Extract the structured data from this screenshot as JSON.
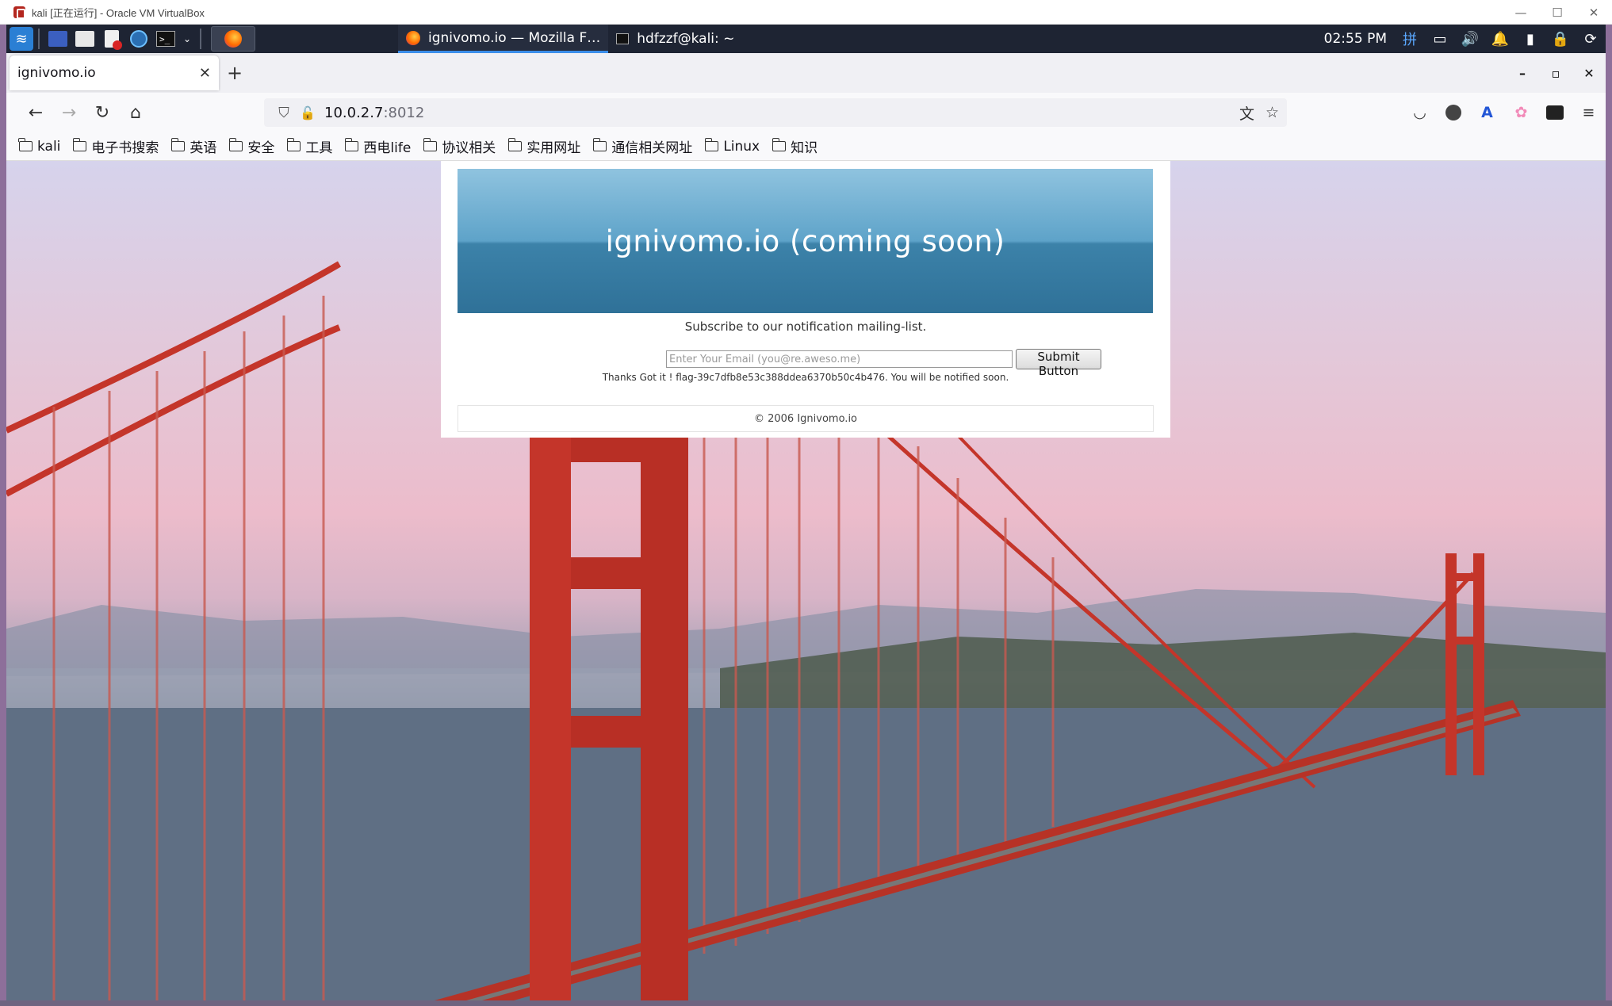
{
  "host_window": {
    "title": "kali [正在运行] - Oracle VM VirtualBox",
    "controls": {
      "minimize": "—",
      "maximize": "☐",
      "close": "✕"
    }
  },
  "panel": {
    "tasks": [
      {
        "label": "ignivomo.io — Mozilla F…",
        "icon": "firefox-icon",
        "active": true
      },
      {
        "label": "hdfzzf@kali: ~",
        "icon": "terminal-icon",
        "active": false
      }
    ],
    "clock": "02:55 PM",
    "ime": "拼"
  },
  "browser": {
    "tab": {
      "label": "ignivomo.io",
      "close": "✕"
    },
    "new_tab": "+",
    "window_controls": {
      "minimize": "–",
      "maximize": "▫",
      "close": "✕"
    },
    "url": {
      "host": "10.0.2.7",
      "port": ":8012"
    },
    "bookmarks": [
      "kali",
      "电子书搜索",
      "英语",
      "安全",
      "工具",
      "西电life",
      "协议相关",
      "实用网址",
      "通信相关网址",
      "Linux",
      "知识"
    ]
  },
  "page": {
    "banner_title": "ignivomo.io (coming soon)",
    "subscribe_text": "Subscribe to our notification mailing-list.",
    "email_placeholder": "Enter Your Email (you@re.aweso.me)",
    "email_value": "",
    "submit_label": "Submit Button",
    "thanks_text": "Thanks Got it ! flag-39c7dfb8e53c388ddea6370b50c4b476. You will be notified soon.",
    "footer": "© 2006 Ignivomo.io",
    "colors": {
      "banner_top": "#8fc3df",
      "banner_bottom": "#2f7198",
      "bridge": "#c4352a"
    }
  }
}
